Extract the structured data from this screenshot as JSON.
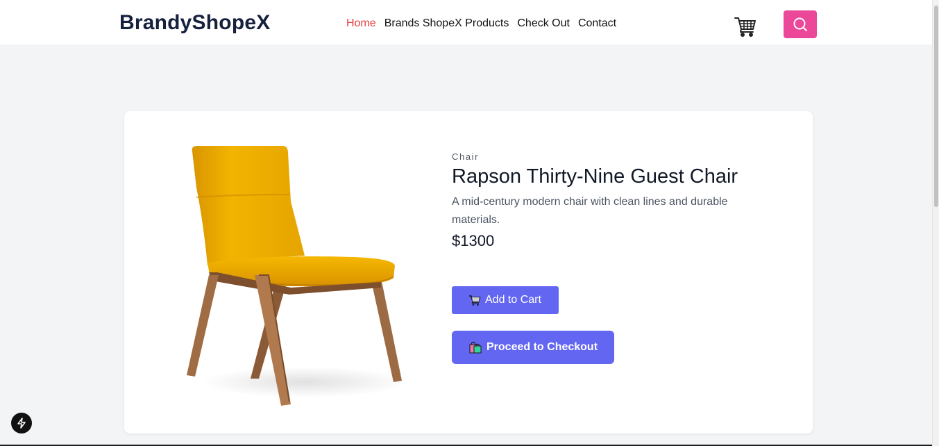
{
  "header": {
    "brand": "BrandyShopeX",
    "nav": [
      {
        "label": "Home",
        "active": true
      },
      {
        "label": "Brands ShopeX Products",
        "active": false
      },
      {
        "label": "Check Out",
        "active": false
      },
      {
        "label": "Contact",
        "active": false
      }
    ],
    "cart_icon": "shopping-cart-icon",
    "search_icon": "search-icon"
  },
  "product": {
    "category": "Chair",
    "name": "Rapson Thirty-Nine Guest Chair",
    "description": "A mid-century modern chair with clean lines and durable materials.",
    "price": "$1300",
    "add_to_cart_label": "Add to Cart",
    "checkout_label": "Proceed to Checkout"
  },
  "colors": {
    "accent": "#6366f1",
    "search_button": "#ec4899",
    "nav_active": "#e53e3e",
    "chair_seat": "#f0b000",
    "chair_wood": "#9a6a44"
  }
}
